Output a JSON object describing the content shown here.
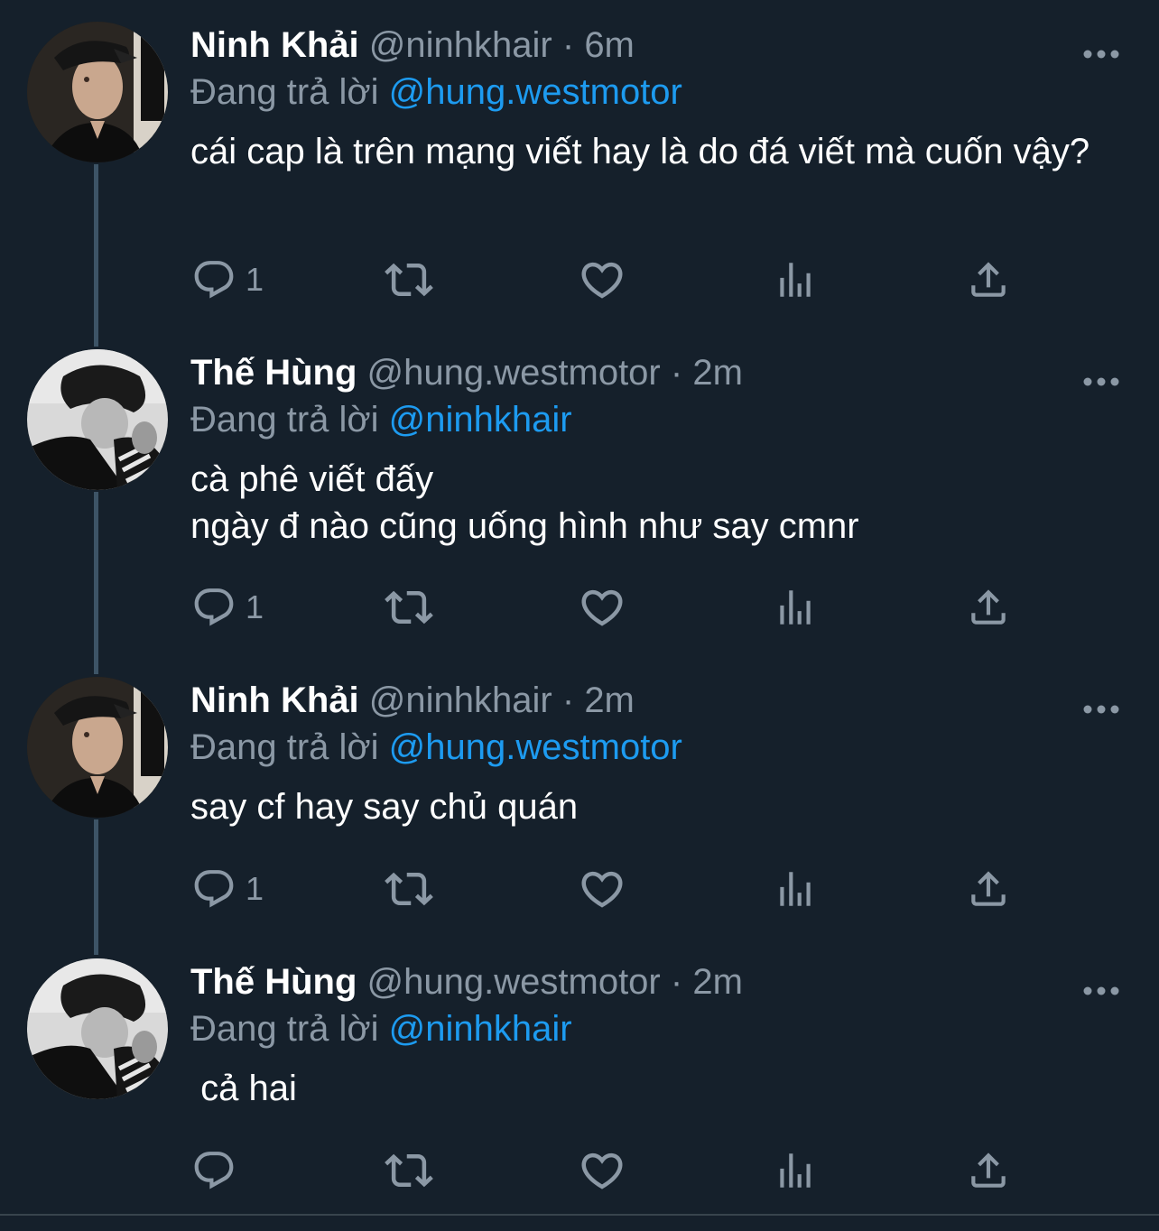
{
  "replying_prefix": "Đang trả lời",
  "tweets": [
    {
      "name": "Ninh Khải",
      "handle": "@ninhkhair",
      "separator": "·",
      "time": "6m",
      "replying_to": "@hung.westmotor",
      "text": "cái cap là trên mạng viết hay là do đá viết mà cuốn vậy?",
      "reply_count": "1",
      "avatar": "avatar-cap"
    },
    {
      "name": "Thế Hùng",
      "handle": "@hung.westmotor",
      "separator": "·",
      "time": "2m",
      "replying_to": "@ninhkhair",
      "text": "cà phê viết đấy\nngày đ nào cũng uống hình như say cmnr",
      "reply_count": "1",
      "avatar": "avatar-bw"
    },
    {
      "name": "Ninh Khải",
      "handle": "@ninhkhair",
      "separator": "·",
      "time": "2m",
      "replying_to": "@hung.westmotor",
      "text": "say cf hay say chủ quán",
      "reply_count": "1",
      "avatar": "avatar-cap"
    },
    {
      "name": "Thế Hùng",
      "handle": "@hung.westmotor",
      "separator": "·",
      "time": "2m",
      "replying_to": "@ninhkhair",
      "text": " cả hai",
      "reply_count": "",
      "avatar": "avatar-bw"
    }
  ],
  "colors": {
    "background": "#15202b",
    "text": "#ffffff",
    "secondary": "#8b98a5",
    "mention": "#1d9bf0",
    "thread_line": "#3d5466"
  },
  "icons": [
    "reply-icon",
    "retweet-icon",
    "like-icon",
    "analytics-icon",
    "share-icon",
    "more-icon"
  ]
}
